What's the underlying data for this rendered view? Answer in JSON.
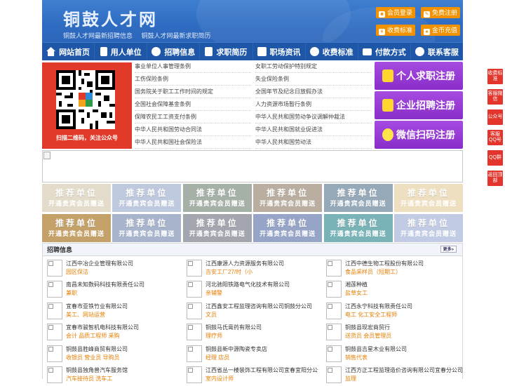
{
  "header": {
    "title": "铜鼓人才网",
    "taglines": [
      "铜鼓人才网最新招聘信息",
      "铜鼓人才网最新求职简历"
    ],
    "buttons": [
      {
        "label": "会员登录",
        "icon": "user-icon"
      },
      {
        "label": "免费注册",
        "icon": "pencil-icon"
      },
      {
        "label": "收费标准",
        "icon": "yen-icon"
      },
      {
        "label": "金币充值",
        "icon": "coin-icon"
      }
    ]
  },
  "nav": [
    {
      "label": "网站首页",
      "icon": "home-icon"
    },
    {
      "label": "用人单位",
      "icon": "building-icon"
    },
    {
      "label": "招聘信息",
      "icon": "people-icon"
    },
    {
      "label": "求职简历",
      "icon": "resume-icon"
    },
    {
      "label": "职场资讯",
      "icon": "news-icon"
    },
    {
      "label": "收费标准",
      "icon": "price-icon"
    },
    {
      "label": "付款方式",
      "icon": "payment-icon"
    },
    {
      "label": "联系客服",
      "icon": "phone-icon"
    }
  ],
  "qr": {
    "caption": "扫描二维码，关注公众号"
  },
  "laws": {
    "left": [
      "事业单位人事管理条例",
      "工伤保险条例",
      "国务院关于职工工作时间的规定",
      "全国社会保障基金条例",
      "保障农民工工资支付条例",
      "中华人民共和国劳动合同法",
      "中华人民共和国社会保险法"
    ],
    "right": [
      "女职工劳动保护特别规定",
      "失业保险条例",
      "全国年节及纪念日放假办法",
      "人力资源市场暂行条例",
      "中华人民共和国劳动争议调解仲裁法",
      "中华人民共和国就业促进法",
      "中华人民共和国劳动法"
    ]
  },
  "register": [
    {
      "label": "个人求职注册",
      "icon": "person-icon"
    },
    {
      "label": "企业招聘注册",
      "icon": "company-icon"
    },
    {
      "label": "微信扫码注册",
      "icon": "wechat-icon"
    }
  ],
  "recommend": {
    "title": "推荐单位",
    "sub": "开通贵宾会员赠送",
    "colors": [
      "#e4dccb",
      "#bfc9dd",
      "#a5b0a7",
      "#b9ae9f",
      "#96a9b9",
      "#eedfc0",
      "#c5a16a",
      "#a8b4cc",
      "#a3a6ae",
      "#96a4c7",
      "#79b3b7",
      "#c2cbe4"
    ]
  },
  "jobs": {
    "heading": "招聘信息",
    "more": "更多»",
    "items": [
      {
        "company": "江西中冶企业管理有限公司",
        "title": "园区保洁"
      },
      {
        "company": "江西康源人力资源服务有限公司",
        "title": "吉安工厂27/时（小"
      },
      {
        "company": "江西中德生物工程股份有限公司",
        "title": "食品采样员（短期工）"
      },
      {
        "company": "南昌未知数码科技有限责任公司",
        "title": "兼职"
      },
      {
        "company": "河北驰阳铁路电气化技术有限公司",
        "title": "亲辅警"
      },
      {
        "company": "湘莲种植",
        "title": "盐草女工"
      },
      {
        "company": "宜春市亚铁竹业有限公司",
        "title": "美工、网站运营"
      },
      {
        "company": "江西鑫安工程监理咨询有限公司铜鼓分公司",
        "title": "文员"
      },
      {
        "company": "江西永宁科技有限责任公司",
        "title": "电工 化工安全工程师"
      },
      {
        "company": "宜春市骏智机电科技有限公司",
        "title": "会计 品质工程师 采购"
      },
      {
        "company": "铜鼓马氏膏药有限公司",
        "title": "理疗师"
      },
      {
        "company": "铜鼓县现宏商贸行",
        "title": "送货员 会员管理员"
      },
      {
        "company": "铜鼓县胜峰商贸有限公司",
        "title": "收银员 营业员 导购员"
      },
      {
        "company": "铜鼓县新中源陶瓷专卖店",
        "title": "经理 店员"
      },
      {
        "company": "铜鼓县吉星木业有限公司",
        "title": "销售代表"
      },
      {
        "company": "铜鼓县独角兽汽车服务馆",
        "title": "汽车接待员 洗车工"
      },
      {
        "company": "江西省丛一楼装饰工程有限公司宜春宜阳分公",
        "title": "室内设计师"
      },
      {
        "company": "江西方正工程监理造价咨询有限公司宜春分公司",
        "title": "监理"
      }
    ]
  },
  "float": [
    {
      "label": "收费标准"
    },
    {
      "label": "客服微信"
    },
    {
      "label": "公众号"
    },
    {
      "label": "客服QQ号"
    },
    {
      "label": "QQ群"
    },
    {
      "label": "返回顶部"
    }
  ]
}
